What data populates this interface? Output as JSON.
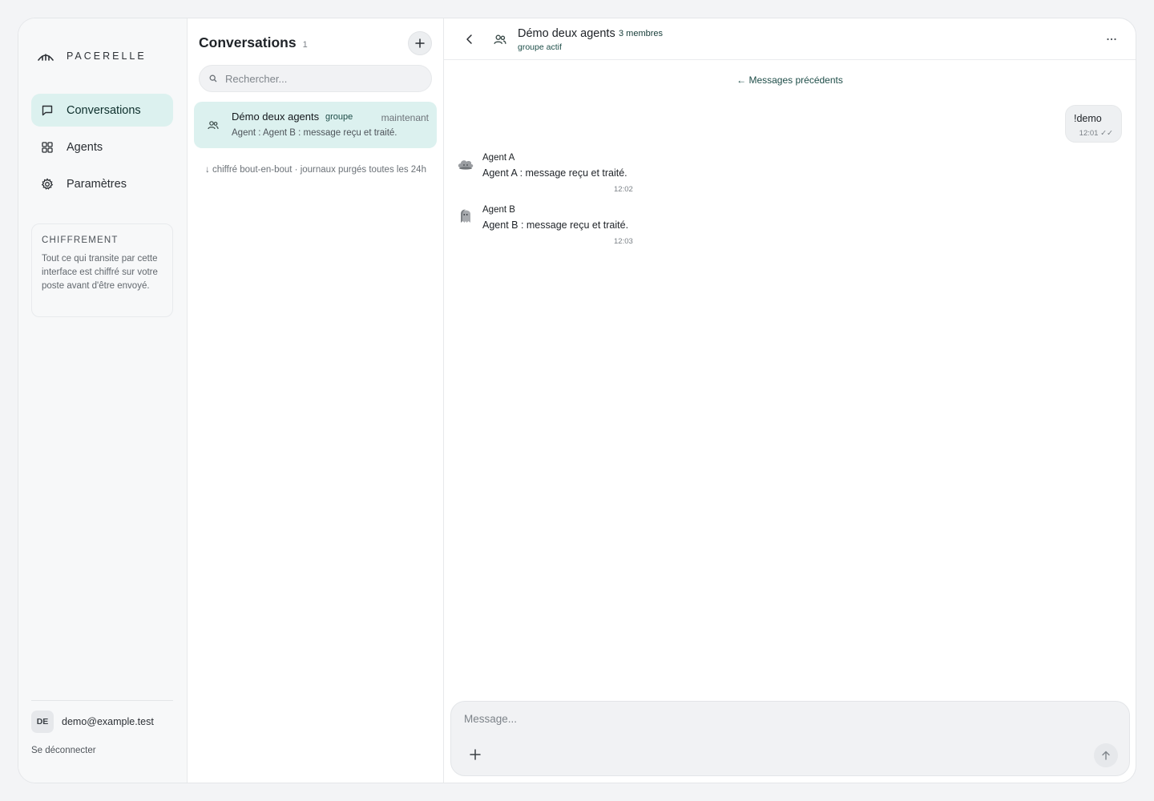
{
  "brand": {
    "name": "PACERELLE",
    "icon": "bridge-logo-icon"
  },
  "sidebar": {
    "nav": [
      {
        "label": "Conversations",
        "icon": "chat-bubble-icon",
        "active": true
      },
      {
        "label": "Agents",
        "icon": "grid-icon",
        "active": false
      },
      {
        "label": "Paramètres",
        "icon": "gear-icon",
        "active": false
      }
    ],
    "encryption": {
      "title": "CHIFFREMENT",
      "text": "Tout ce qui transite par cette interface est chiffré sur votre poste avant d'être envoyé."
    },
    "user": {
      "initials": "DE",
      "email": "demo@example.test"
    },
    "logout_label": "Se déconnecter"
  },
  "conversations": {
    "title": "Conversations",
    "count": "1",
    "search_placeholder": "Rechercher...",
    "items": [
      {
        "name": "Démo deux agents",
        "tag": "groupe",
        "time": "maintenant",
        "preview": "Agent : Agent B : message reçu et traité."
      }
    ],
    "note": "↓ chiffré bout-en-bout · journaux purgés toutes les 24h"
  },
  "chat": {
    "title": "Démo deux agents",
    "members": "3 membres",
    "status": "groupe actif",
    "older_label": "← Messages précédents",
    "outgoing": {
      "text": "!demo",
      "time": "12:01 ✓✓"
    },
    "messages": [
      {
        "sender": "Agent A",
        "text": "Agent A : message reçu et traité.",
        "time": "12:02",
        "avatar": "cloud-avatar-icon"
      },
      {
        "sender": "Agent B",
        "text": "Agent B : message reçu et traité.",
        "time": "12:03",
        "avatar": "ghost-avatar-icon"
      }
    ],
    "composer_placeholder": "Message..."
  },
  "colors": {
    "accent": "#dcf1ef",
    "accent_text": "#1e4d48",
    "background": "#f3f4f6"
  }
}
